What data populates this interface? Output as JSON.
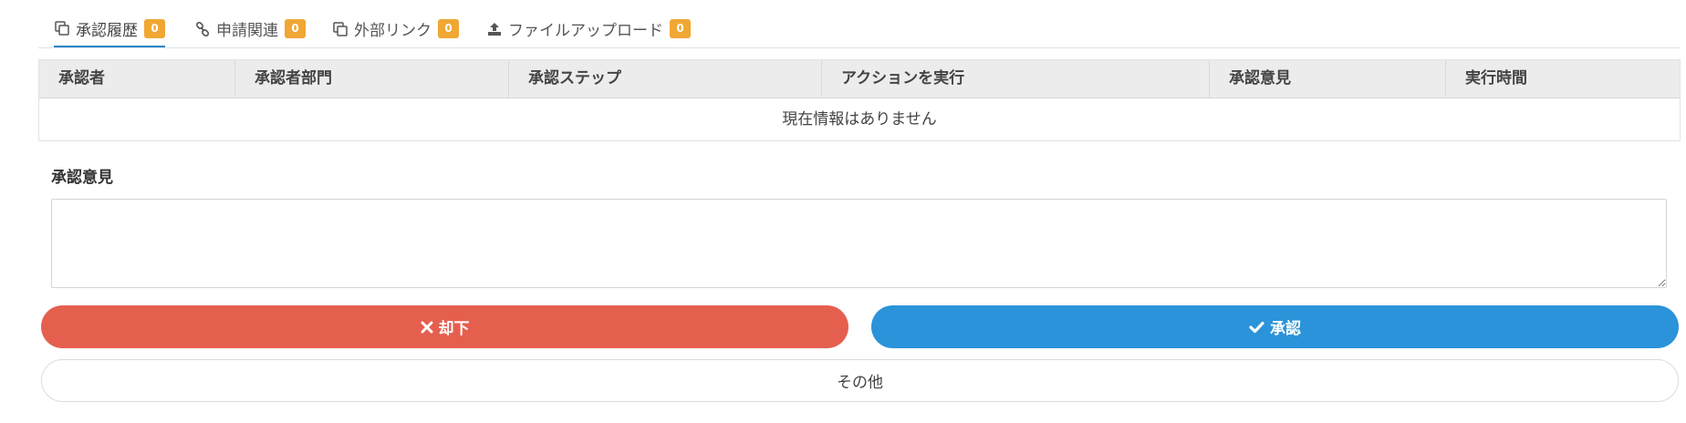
{
  "tabs": [
    {
      "label": "承認履歴",
      "count": "0",
      "icon": "copy-icon"
    },
    {
      "label": "申請関連",
      "count": "0",
      "icon": "link-icon"
    },
    {
      "label": "外部リンク",
      "count": "0",
      "icon": "copy-icon"
    },
    {
      "label": "ファイルアップロード",
      "count": "0",
      "icon": "upload-icon"
    }
  ],
  "table": {
    "columns": [
      "承認者",
      "承認者部門",
      "承認ステップ",
      "アクションを実行",
      "承認意見",
      "実行時間"
    ],
    "empty_message": "現在情報はありません"
  },
  "comment": {
    "label": "承認意見",
    "value": ""
  },
  "buttons": {
    "reject_label": "却下",
    "approve_label": "承認",
    "other_label": "その他"
  },
  "colors": {
    "badge": "#f0a733",
    "active_tab": "#2b86c5",
    "reject": "#e55f4f",
    "approve": "#2b93d9"
  }
}
